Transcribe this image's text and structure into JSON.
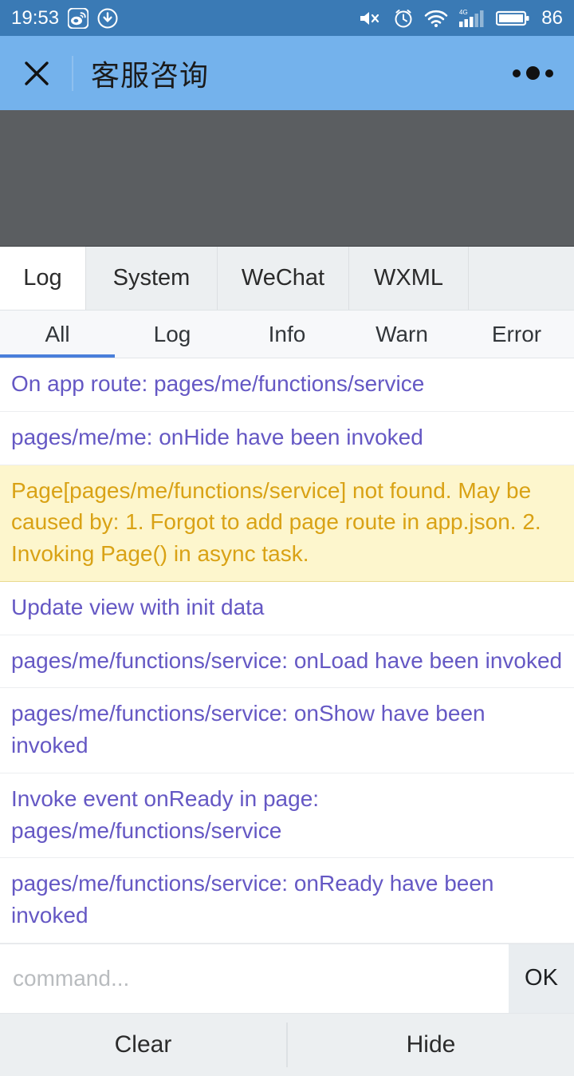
{
  "statusbar": {
    "time": "19:53",
    "battery_level": "86",
    "left_icons": [
      "weibo-icon",
      "download-arrow-icon"
    ],
    "right_icons": [
      "volume-mute-icon",
      "alarm-clock-icon",
      "wifi-icon",
      "signal-4g-icon",
      "battery-icon"
    ],
    "background": "#3a7ab5",
    "foreground": "#ffffff"
  },
  "navbar": {
    "title": "客服咨询",
    "close_icon": "close-icon",
    "more_icon": "more-options-icon",
    "background": "#74b2ec"
  },
  "console": {
    "tabs": [
      {
        "label": "Log",
        "active": true
      },
      {
        "label": "System",
        "active": false
      },
      {
        "label": "WeChat",
        "active": false
      },
      {
        "label": "WXML",
        "active": false
      }
    ],
    "filters": [
      {
        "label": "All",
        "active": true
      },
      {
        "label": "Log",
        "active": false
      },
      {
        "label": "Info",
        "active": false
      },
      {
        "label": "Warn",
        "active": false
      },
      {
        "label": "Error",
        "active": false
      }
    ],
    "active_filter_color": "#4a7fdb",
    "log_text_color": "#6558c4",
    "warn_text_color": "#d9a215",
    "warn_background": "#fdf6cd",
    "entries": [
      {
        "level": "log",
        "text": "On app route: pages/me/functions/service"
      },
      {
        "level": "log",
        "text": "pages/me/me: onHide have been invoked"
      },
      {
        "level": "warn",
        "text": "Page[pages/me/functions/service] not found. May be caused by: 1. Forgot to add page route in app.json. 2. Invoking Page() in async task."
      },
      {
        "level": "log",
        "text": "Update view with init data"
      },
      {
        "level": "log",
        "text": "pages/me/functions/service: onLoad have been invoked"
      },
      {
        "level": "log",
        "text": "pages/me/functions/service: onShow have been invoked"
      },
      {
        "level": "log",
        "text": "Invoke event onReady in page: pages/me/functions/service"
      },
      {
        "level": "log",
        "text": "pages/me/functions/service: onReady have been invoked"
      }
    ],
    "command": {
      "value": "",
      "placeholder": "command...",
      "submit_label": "OK"
    },
    "actions": [
      {
        "label": "Clear"
      },
      {
        "label": "Hide"
      }
    ]
  }
}
